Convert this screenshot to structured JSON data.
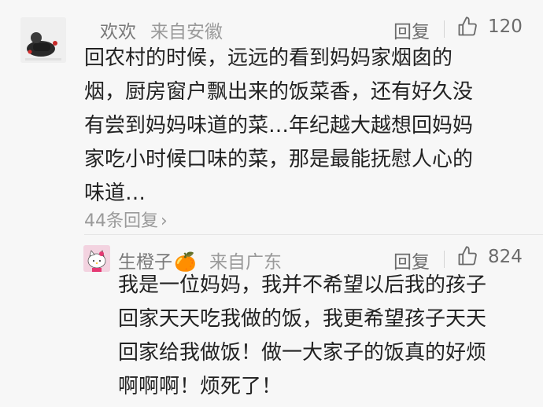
{
  "comments": [
    {
      "author": "欢欢",
      "source": "来自安徽",
      "reply_label": "回复",
      "likes": "120",
      "body_lines": [
        "回农村的时候，远远的看到妈妈家烟囱的",
        "烟，厨房窗户飘出来的饭菜香，还有好久没",
        "有尝到妈妈味道的菜…年纪越大越想回妈妈",
        "家吃小时候口味的菜，那是最能抚慰人心的",
        "味道…"
      ],
      "more_replies": "44条回复",
      "more_replies_chevron": "›"
    },
    {
      "author": "生橙子",
      "author_emoji": "🍊",
      "source": "来自广东",
      "reply_label": "回复",
      "likes": "824",
      "body_lines": [
        "我是一位妈妈，我并不希望以后我的孩子",
        "回家天天吃我做的饭，我更希望孩子天天",
        "回家给我做饭！做一大家子的饭真的好烦",
        "啊啊啊！烦死了！"
      ]
    }
  ],
  "icons": {
    "like": "thumbs-up-icon",
    "avatar1": "user-avatar",
    "avatar2": "hello-kitty-avatar"
  }
}
